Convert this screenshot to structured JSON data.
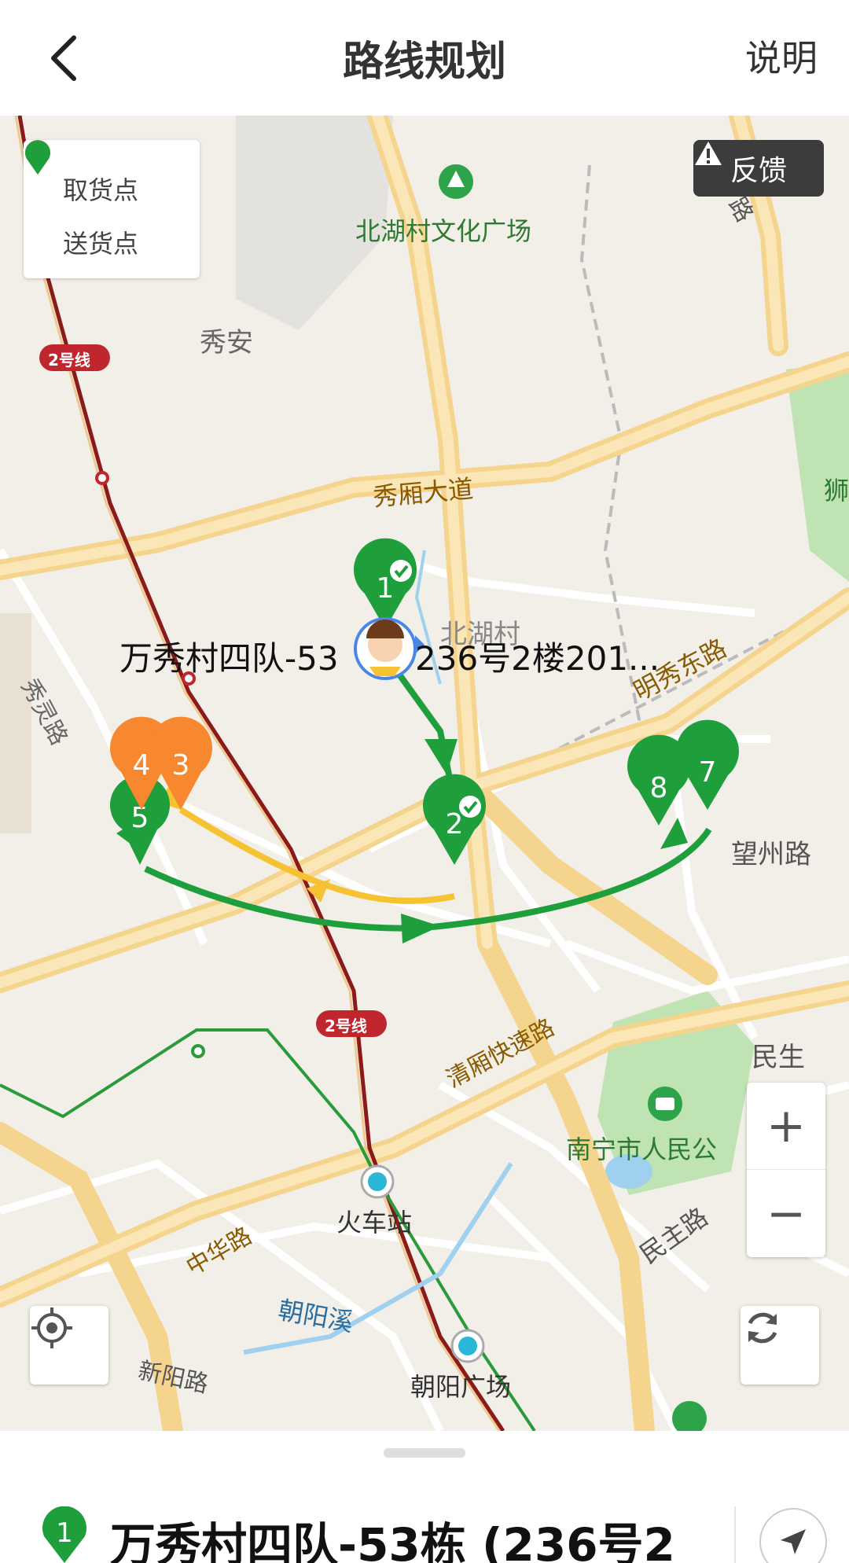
{
  "header": {
    "title": "路线规划",
    "explain": "说明"
  },
  "legend": {
    "pickup": "取货点",
    "delivery": "送货点",
    "pickup_color": "#f7882f",
    "delivery_color": "#1f9e3c"
  },
  "feedback": {
    "label": "反馈"
  },
  "map": {
    "labels": {
      "beihu_square": "北湖村文化广场",
      "xiuan": "秀安",
      "line2_a": "2号线",
      "line2_b": "2号线",
      "xiuxiang": "秀厢大道",
      "beihu": "北湖村",
      "mingxiu": "明秀东路",
      "xiuling": "秀灵路",
      "wangzhou": "望州路",
      "qingxiang": "清厢快速路",
      "minsheng": "民生",
      "park": "南宁市人民公",
      "train_station": "火车站",
      "zhonghua": "中华路",
      "minzhu": "民主路",
      "chaoyangxi": "朝阳溪",
      "xinyang": "新阳路",
      "chaoyang_square": "朝阳广场",
      "shi": "狮",
      "lu": "路"
    },
    "current_address": "万秀村四队-53",
    "current_address_tail": "236号2楼201...",
    "markers": [
      {
        "num": "1",
        "type": "delivery",
        "done": true
      },
      {
        "num": "2",
        "type": "delivery",
        "done": true
      },
      {
        "num": "3",
        "type": "pickup"
      },
      {
        "num": "4",
        "type": "pickup"
      },
      {
        "num": "5",
        "type": "delivery"
      },
      {
        "num": "7",
        "type": "delivery"
      },
      {
        "num": "8",
        "type": "delivery"
      }
    ],
    "route_colors": {
      "delivery": "#1f9e3c",
      "pickup": "#f7c232"
    }
  },
  "controls": {
    "zoom_in": "+",
    "zoom_out": "−"
  },
  "sheet": {
    "pin_num": "1",
    "title": "万秀村四队-53栋 (236号2"
  }
}
